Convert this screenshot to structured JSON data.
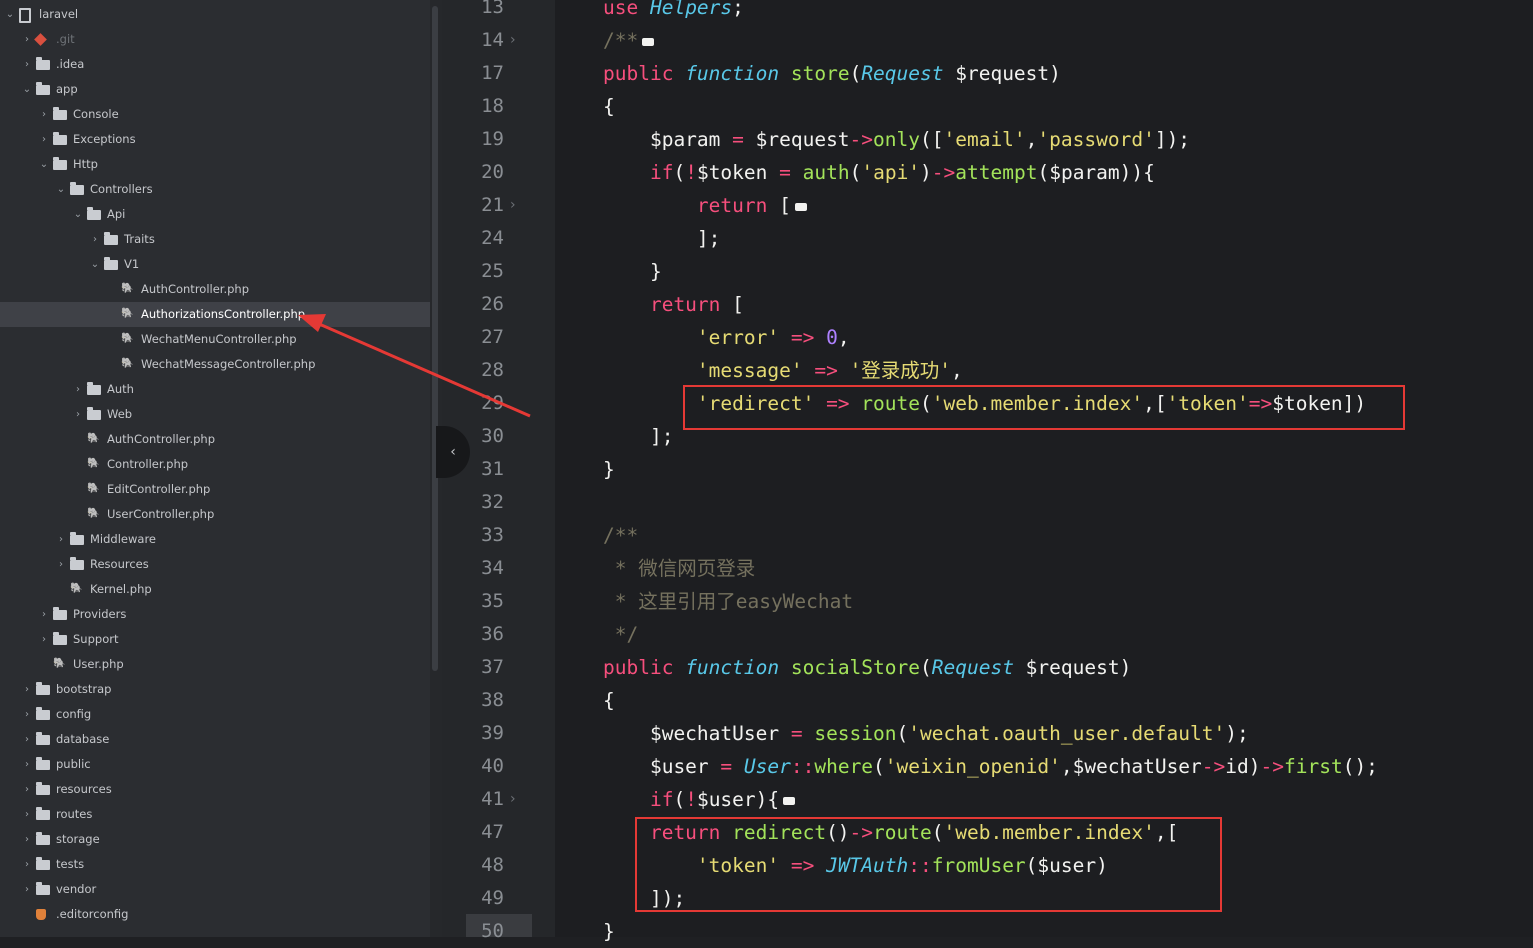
{
  "project": "laravel",
  "tree": [
    {
      "label": "laravel",
      "icon": "repo-icon",
      "chev": "v",
      "depth": 0
    },
    {
      "label": ".git",
      "icon": "git-icon",
      "chev": ">",
      "depth": 1,
      "dim": true
    },
    {
      "label": ".idea",
      "icon": "folder-icon",
      "chev": ">",
      "depth": 1
    },
    {
      "label": "app",
      "icon": "folder-icon",
      "chev": "v",
      "depth": 1
    },
    {
      "label": "Console",
      "icon": "folder-icon",
      "chev": ">",
      "depth": 2
    },
    {
      "label": "Exceptions",
      "icon": "folder-icon",
      "chev": ">",
      "depth": 2
    },
    {
      "label": "Http",
      "icon": "folder-icon",
      "chev": "v",
      "depth": 2
    },
    {
      "label": "Controllers",
      "icon": "folder-icon",
      "chev": "v",
      "depth": 3
    },
    {
      "label": "Api",
      "icon": "folder-icon",
      "chev": "v",
      "depth": 4
    },
    {
      "label": "Traits",
      "icon": "folder-icon",
      "chev": ">",
      "depth": 5
    },
    {
      "label": "V1",
      "icon": "folder-icon",
      "chev": "v",
      "depth": 5
    },
    {
      "label": "AuthController.php",
      "icon": "php-icon",
      "chev": "",
      "depth": 6
    },
    {
      "label": "AuthorizationsController.php",
      "icon": "php-icon",
      "chev": "",
      "depth": 6,
      "selected": true
    },
    {
      "label": "WechatMenuController.php",
      "icon": "php-icon",
      "chev": "",
      "depth": 6
    },
    {
      "label": "WechatMessageController.php",
      "icon": "php-icon",
      "chev": "",
      "depth": 6
    },
    {
      "label": "Auth",
      "icon": "folder-icon",
      "chev": ">",
      "depth": 4
    },
    {
      "label": "Web",
      "icon": "folder-icon",
      "chev": ">",
      "depth": 4
    },
    {
      "label": "AuthController.php",
      "icon": "php-icon",
      "chev": "",
      "depth": 4
    },
    {
      "label": "Controller.php",
      "icon": "php-icon",
      "chev": "",
      "depth": 4
    },
    {
      "label": "EditController.php",
      "icon": "php-icon",
      "chev": "",
      "depth": 4
    },
    {
      "label": "UserController.php",
      "icon": "php-icon",
      "chev": "",
      "depth": 4
    },
    {
      "label": "Middleware",
      "icon": "folder-icon",
      "chev": ">",
      "depth": 3
    },
    {
      "label": "Resources",
      "icon": "folder-icon",
      "chev": ">",
      "depth": 3
    },
    {
      "label": "Kernel.php",
      "icon": "php-icon",
      "chev": "",
      "depth": 3
    },
    {
      "label": "Providers",
      "icon": "folder-icon",
      "chev": ">",
      "depth": 2
    },
    {
      "label": "Support",
      "icon": "folder-icon",
      "chev": ">",
      "depth": 2
    },
    {
      "label": "User.php",
      "icon": "php-icon",
      "chev": "",
      "depth": 2
    },
    {
      "label": "bootstrap",
      "icon": "folder-icon",
      "chev": ">",
      "depth": 1
    },
    {
      "label": "config",
      "icon": "folder-icon",
      "chev": ">",
      "depth": 1
    },
    {
      "label": "database",
      "icon": "folder-icon",
      "chev": ">",
      "depth": 1
    },
    {
      "label": "public",
      "icon": "folder-icon",
      "chev": ">",
      "depth": 1
    },
    {
      "label": "resources",
      "icon": "folder-icon",
      "chev": ">",
      "depth": 1
    },
    {
      "label": "routes",
      "icon": "folder-icon",
      "chev": ">",
      "depth": 1
    },
    {
      "label": "storage",
      "icon": "folder-icon",
      "chev": ">",
      "depth": 1
    },
    {
      "label": "tests",
      "icon": "folder-icon",
      "chev": ">",
      "depth": 1
    },
    {
      "label": "vendor",
      "icon": "folder-icon",
      "chev": ">",
      "depth": 1
    },
    {
      "label": ".editorconfig",
      "icon": "config-icon",
      "chev": "",
      "depth": 1
    }
  ],
  "gutter": [
    {
      "n": "13",
      "fold": false
    },
    {
      "n": "14",
      "fold": true
    },
    {
      "n": "17",
      "fold": false
    },
    {
      "n": "18",
      "fold": false
    },
    {
      "n": "19",
      "fold": false
    },
    {
      "n": "20",
      "fold": false
    },
    {
      "n": "21",
      "fold": true
    },
    {
      "n": "24",
      "fold": false
    },
    {
      "n": "25",
      "fold": false
    },
    {
      "n": "26",
      "fold": false
    },
    {
      "n": "27",
      "fold": false
    },
    {
      "n": "28",
      "fold": false
    },
    {
      "n": "29",
      "fold": false
    },
    {
      "n": "30",
      "fold": false
    },
    {
      "n": "31",
      "fold": false
    },
    {
      "n": "32",
      "fold": false
    },
    {
      "n": "33",
      "fold": false
    },
    {
      "n": "34",
      "fold": false
    },
    {
      "n": "35",
      "fold": false
    },
    {
      "n": "36",
      "fold": false
    },
    {
      "n": "37",
      "fold": false
    },
    {
      "n": "38",
      "fold": false
    },
    {
      "n": "39",
      "fold": false
    },
    {
      "n": "40",
      "fold": false
    },
    {
      "n": "41",
      "fold": true
    },
    {
      "n": "47",
      "fold": false
    },
    {
      "n": "48",
      "fold": false
    },
    {
      "n": "49",
      "fold": false
    },
    {
      "n": "50",
      "fold": false
    }
  ],
  "code": [
    [
      [
        "kw",
        "use "
      ],
      [
        "ty",
        "Helpers"
      ],
      [
        "vr",
        ";"
      ]
    ],
    [
      [
        "cm",
        "/**"
      ],
      [
        "dots",
        ""
      ]
    ],
    [
      [
        "kw",
        "public "
      ],
      [
        "ty",
        "function "
      ],
      [
        "fn",
        "store"
      ],
      [
        "vr",
        "("
      ],
      [
        "ty",
        "Request "
      ],
      [
        "vr",
        "$request)"
      ]
    ],
    [
      [
        "vr",
        "{"
      ]
    ],
    [
      [
        "vr",
        "    $param "
      ],
      [
        "op",
        "= "
      ],
      [
        "vr",
        "$request"
      ],
      [
        "op",
        "->"
      ],
      [
        "fn",
        "only"
      ],
      [
        "vr",
        "(["
      ],
      [
        "st",
        "'email'"
      ],
      [
        "vr",
        ","
      ],
      [
        "st",
        "'password'"
      ],
      [
        "vr",
        "]);"
      ]
    ],
    [
      [
        "kw",
        "    if"
      ],
      [
        "vr",
        "("
      ],
      [
        "op",
        "!"
      ],
      [
        "vr",
        "$token "
      ],
      [
        "op",
        "= "
      ],
      [
        "fn",
        "auth"
      ],
      [
        "vr",
        "("
      ],
      [
        "st",
        "'api'"
      ],
      [
        "vr",
        ")"
      ],
      [
        "op",
        "->"
      ],
      [
        "fn",
        "attempt"
      ],
      [
        "vr",
        "($param)){"
      ]
    ],
    [
      [
        "kw",
        "        return "
      ],
      [
        "vr",
        "["
      ],
      [
        "dots",
        ""
      ]
    ],
    [
      [
        "vr",
        "        ];"
      ]
    ],
    [
      [
        "vr",
        "    }"
      ]
    ],
    [
      [
        "kw",
        "    return "
      ],
      [
        "vr",
        "["
      ]
    ],
    [
      [
        "st",
        "        'error' "
      ],
      [
        "op",
        "=> "
      ],
      [
        "nu",
        "0"
      ],
      [
        "vr",
        ","
      ]
    ],
    [
      [
        "st",
        "        'message' "
      ],
      [
        "op",
        "=> "
      ],
      [
        "st",
        "'登录成功'"
      ],
      [
        "vr",
        ","
      ]
    ],
    [
      [
        "st",
        "        'redirect' "
      ],
      [
        "op",
        "=> "
      ],
      [
        "fn",
        "route"
      ],
      [
        "vr",
        "("
      ],
      [
        "st",
        "'web.member.index'"
      ],
      [
        "vr",
        ",["
      ],
      [
        "st",
        "'token'"
      ],
      [
        "op",
        "=>"
      ],
      [
        "vr",
        "$token])"
      ]
    ],
    [
      [
        "vr",
        "    ];"
      ]
    ],
    [
      [
        "vr",
        "}"
      ]
    ],
    [
      [
        "vr",
        ""
      ]
    ],
    [
      [
        "cm",
        "/**"
      ]
    ],
    [
      [
        "cm",
        " * 微信网页登录"
      ]
    ],
    [
      [
        "cm",
        " * 这里引用了easyWechat"
      ]
    ],
    [
      [
        "cm",
        " */"
      ]
    ],
    [
      [
        "kw",
        "public "
      ],
      [
        "ty",
        "function "
      ],
      [
        "fn",
        "socialStore"
      ],
      [
        "vr",
        "("
      ],
      [
        "ty",
        "Request "
      ],
      [
        "vr",
        "$request)"
      ]
    ],
    [
      [
        "vr",
        "{"
      ]
    ],
    [
      [
        "vr",
        "    $wechatUser "
      ],
      [
        "op",
        "= "
      ],
      [
        "fn",
        "session"
      ],
      [
        "vr",
        "("
      ],
      [
        "st",
        "'wechat.oauth_user.default'"
      ],
      [
        "vr",
        ");"
      ]
    ],
    [
      [
        "vr",
        "    $user "
      ],
      [
        "op",
        "= "
      ],
      [
        "ty",
        "User"
      ],
      [
        "op",
        "::"
      ],
      [
        "fn",
        "where"
      ],
      [
        "vr",
        "("
      ],
      [
        "st",
        "'weixin_openid'"
      ],
      [
        "vr",
        ",$wechatUser"
      ],
      [
        "op",
        "->"
      ],
      [
        "vr",
        "id)"
      ],
      [
        "op",
        "->"
      ],
      [
        "fn",
        "first"
      ],
      [
        "vr",
        "();"
      ]
    ],
    [
      [
        "kw",
        "    if"
      ],
      [
        "vr",
        "("
      ],
      [
        "op",
        "!"
      ],
      [
        "vr",
        "$user){"
      ],
      [
        "dots",
        ""
      ]
    ],
    [
      [
        "kw",
        "    return "
      ],
      [
        "fn",
        "redirect"
      ],
      [
        "vr",
        "()"
      ],
      [
        "op",
        "->"
      ],
      [
        "fn",
        "route"
      ],
      [
        "vr",
        "("
      ],
      [
        "st",
        "'web.member.index'"
      ],
      [
        "vr",
        ",["
      ]
    ],
    [
      [
        "st",
        "        'token' "
      ],
      [
        "op",
        "=> "
      ],
      [
        "ty",
        "JWTAuth"
      ],
      [
        "op",
        "::"
      ],
      [
        "fn",
        "fromUser"
      ],
      [
        "vr",
        "($user)"
      ]
    ],
    [
      [
        "vr",
        "    ]);"
      ]
    ],
    [
      [
        "vr",
        "}"
      ]
    ]
  ]
}
